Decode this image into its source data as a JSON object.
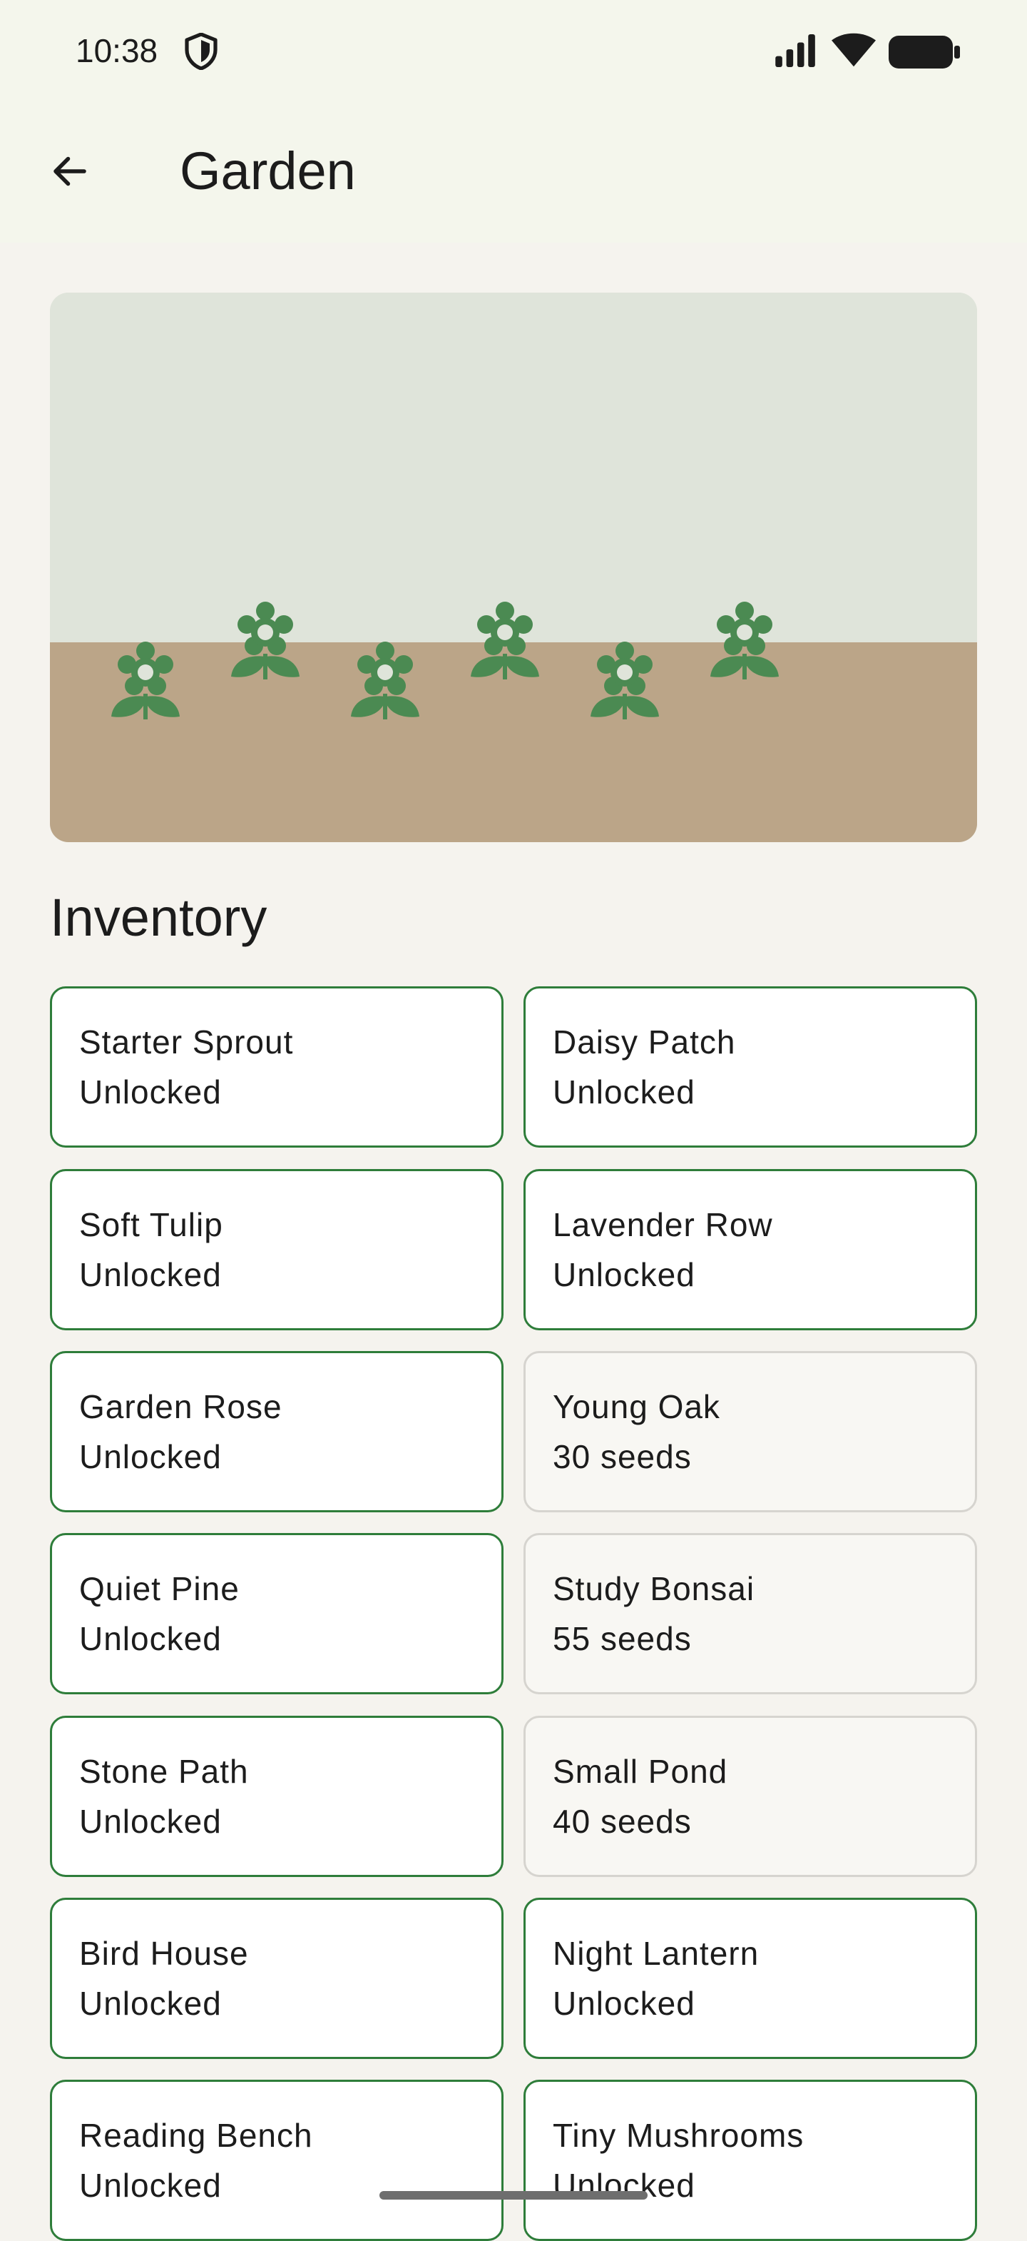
{
  "status_bar": {
    "time": "10:38",
    "icons": [
      "shield-icon",
      "signal-icon",
      "wifi-icon",
      "battery-icon"
    ]
  },
  "app_bar": {
    "back_icon": "arrow-left-icon",
    "title": "Garden"
  },
  "garden": {
    "sky_color": "#dfe4da",
    "soil_color": "#bba588",
    "plant_color": "#4b8a52",
    "plant_count": 6
  },
  "inventory": {
    "title": "Inventory",
    "items": [
      {
        "name": "Starter Sprout",
        "status": "Unlocked",
        "unlocked": true
      },
      {
        "name": "Daisy Patch",
        "status": "Unlocked",
        "unlocked": true
      },
      {
        "name": "Soft Tulip",
        "status": "Unlocked",
        "unlocked": true
      },
      {
        "name": "Lavender Row",
        "status": "Unlocked",
        "unlocked": true
      },
      {
        "name": "Garden Rose",
        "status": "Unlocked",
        "unlocked": true
      },
      {
        "name": "Young Oak",
        "status": "30 seeds",
        "unlocked": false
      },
      {
        "name": "Quiet Pine",
        "status": "Unlocked",
        "unlocked": true
      },
      {
        "name": "Study Bonsai",
        "status": "55 seeds",
        "unlocked": false
      },
      {
        "name": "Stone Path",
        "status": "Unlocked",
        "unlocked": true
      },
      {
        "name": "Small Pond",
        "status": "40 seeds",
        "unlocked": false
      },
      {
        "name": "Bird House",
        "status": "Unlocked",
        "unlocked": true
      },
      {
        "name": "Night Lantern",
        "status": "Unlocked",
        "unlocked": true
      },
      {
        "name": "Reading Bench",
        "status": "Unlocked",
        "unlocked": true
      },
      {
        "name": "Tiny Mushrooms",
        "status": "Unlocked",
        "unlocked": true
      }
    ]
  },
  "colors": {
    "accent": "#2e7d3a",
    "locked_border": "#d6d4cf",
    "background": "#f5f3ee"
  }
}
